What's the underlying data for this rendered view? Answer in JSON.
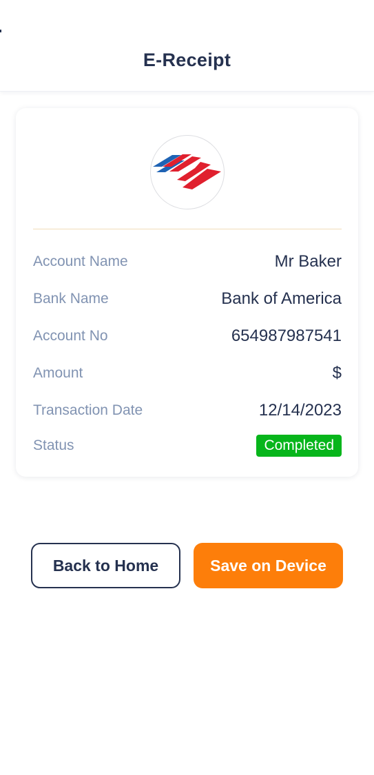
{
  "header": {
    "title": "E-Receipt"
  },
  "bank_logo": {
    "icon": "bank-of-america-logo",
    "colors": {
      "blue": "#1f63b4",
      "red": "#e0202e"
    }
  },
  "receipt": {
    "rows": [
      {
        "label": "Account Name",
        "value": "Mr Baker"
      },
      {
        "label": "Bank Name",
        "value": "Bank of America"
      },
      {
        "label": "Account No",
        "value": "654987987541"
      },
      {
        "label": "Amount",
        "value": "$"
      },
      {
        "label": "Transaction Date",
        "value": "12/14/2023"
      }
    ],
    "status": {
      "label": "Status",
      "value": "Completed",
      "color": "#07b51b"
    }
  },
  "actions": {
    "back_label": "Back to Home",
    "save_label": "Save on Device"
  },
  "colors": {
    "primary_text": "#25314f",
    "muted_label": "#8193b2",
    "accent": "#fd7e0a",
    "divider": "#f1dcb8"
  }
}
